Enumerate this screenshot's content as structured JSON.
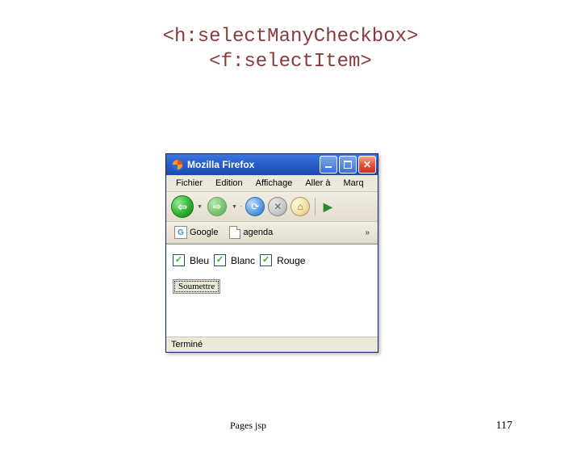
{
  "slide": {
    "title_line1": "<h:selectManyCheckbox>",
    "title_line2": "<f:selectItem>",
    "footer_label": "Pages jsp",
    "page_number": "117"
  },
  "window": {
    "title": "Mozilla Firefox",
    "menu": {
      "file": "Fichier",
      "edit": "Edition",
      "view": "Affichage",
      "go": "Aller à",
      "bookmarks": "Marq"
    },
    "bookmarks": {
      "google": "Google",
      "agenda": "agenda",
      "more": "»"
    },
    "form": {
      "checks": [
        {
          "label": "Bleu",
          "checked": true
        },
        {
          "label": "Blanc",
          "checked": true
        },
        {
          "label": "Rouge",
          "checked": true
        }
      ],
      "submit": "Soumettre"
    },
    "status": "Terminé"
  }
}
